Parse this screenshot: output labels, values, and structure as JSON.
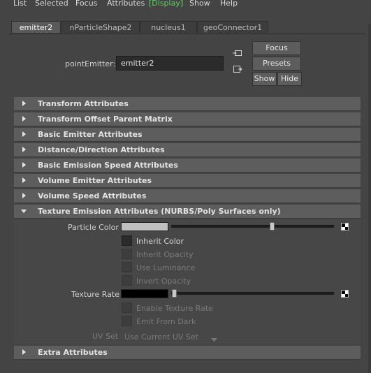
{
  "menubar": {
    "items": [
      "List",
      "Selected",
      "Focus",
      "Attributes",
      "Display",
      "Show",
      "Help"
    ],
    "active_open": "[",
    "active_close": "]"
  },
  "tabs": [
    "emitter2",
    "nParticleShape2",
    "nucleus1",
    "geoConnector1"
  ],
  "node": {
    "label": "pointEmitter:",
    "value": "emitter2"
  },
  "buttons": {
    "focus": "Focus",
    "presets": "Presets",
    "show": "Show",
    "hide": "Hide"
  },
  "sections": [
    "Transform Attributes",
    "Transform Offset Parent Matrix",
    "Basic Emitter Attributes",
    "Distance/Direction Attributes",
    "Basic Emission Speed Attributes",
    "Volume Emitter Attributes",
    "Volume Speed Attributes",
    "Texture Emission Attributes (NURBS/Poly Surfaces only)",
    "Extra Attributes"
  ],
  "texture_emission": {
    "particle_color_label": "Particle Color",
    "particle_color_swatch": "#c0c0c0",
    "particle_color_level": 0.62,
    "inherit_color": "Inherit Color",
    "inherit_opacity": "Inherit Opacity",
    "use_luminance": "Use Luminance",
    "invert_opacity": "Invert Opacity",
    "texture_rate_label": "Texture Rate",
    "texture_rate_swatch": "#000000",
    "texture_rate_level": 0.0,
    "enable_texture_rate": "Enable Texture Rate",
    "emit_from_dark": "Emit From Dark",
    "uv_set_label": "UV Set",
    "uv_set_value": "Use Current UV Set"
  },
  "colors": {
    "active_menu": "#5fd45f",
    "section_header": "#5d5d5d",
    "background": "#444444"
  }
}
